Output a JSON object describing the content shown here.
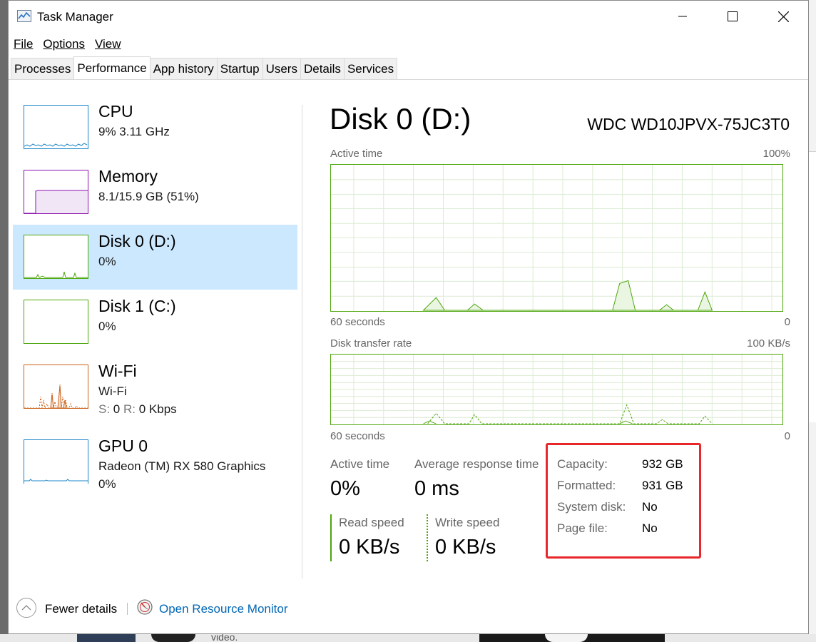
{
  "window": {
    "title": "Task Manager"
  },
  "menu": [
    {
      "label": "File"
    },
    {
      "label": "Options"
    },
    {
      "label": "View"
    }
  ],
  "tabs": [
    {
      "label": "Processes"
    },
    {
      "label": "Performance",
      "active": true
    },
    {
      "label": "App history"
    },
    {
      "label": "Startup"
    },
    {
      "label": "Users"
    },
    {
      "label": "Details"
    },
    {
      "label": "Services"
    }
  ],
  "sidebar": {
    "items": [
      {
        "name": "CPU",
        "line1": "9%  3.11 GHz",
        "color": "#1a84c7"
      },
      {
        "name": "Memory",
        "line1": "8.1/15.9 GB (51%)",
        "color": "#8b12ae"
      },
      {
        "name": "Disk 0 (D:)",
        "line1": "0%",
        "color": "#4da60c",
        "selected": true
      },
      {
        "name": "Disk 1 (C:)",
        "line1": "0%",
        "color": "#4da60c"
      },
      {
        "name": "Wi-Fi",
        "line1": "Wi-Fi",
        "send_label": "S:",
        "send_value": "0",
        "recv_label": "R:",
        "recv_value": "0 Kbps",
        "color": "#c9611b"
      },
      {
        "name": "GPU 0",
        "line1": "Radeon (TM) RX 580 Graphics",
        "line2": "0%",
        "color": "#1a84c7"
      }
    ]
  },
  "main": {
    "title": "Disk 0 (D:)",
    "model": "WDC WD10JPVX-75JC3T0",
    "active_graph": {
      "label": "Active time",
      "max": "100%",
      "x_left": "60 seconds",
      "x_right": "0"
    },
    "transfer_graph": {
      "label": "Disk transfer rate",
      "max": "100 KB/s",
      "x_left": "60 seconds",
      "x_right": "0"
    },
    "stats": {
      "active_time_label": "Active time",
      "active_time_value": "0%",
      "avg_response_label": "Average response time",
      "avg_response_value": "0 ms",
      "read_speed_label": "Read speed",
      "read_speed_value": "0 KB/s",
      "write_speed_label": "Write speed",
      "write_speed_value": "0 KB/s"
    },
    "properties": [
      {
        "key": "Capacity:",
        "value": "932 GB"
      },
      {
        "key": "Formatted:",
        "value": "931 GB"
      },
      {
        "key": "System disk:",
        "value": "No"
      },
      {
        "key": "Page file:",
        "value": "No"
      }
    ],
    "highlight_color": "#e8272b"
  },
  "footer": {
    "fewer_details": "Fewer details",
    "resource_monitor": "Open Resource Monitor"
  },
  "background": {
    "partial_text": "video."
  }
}
